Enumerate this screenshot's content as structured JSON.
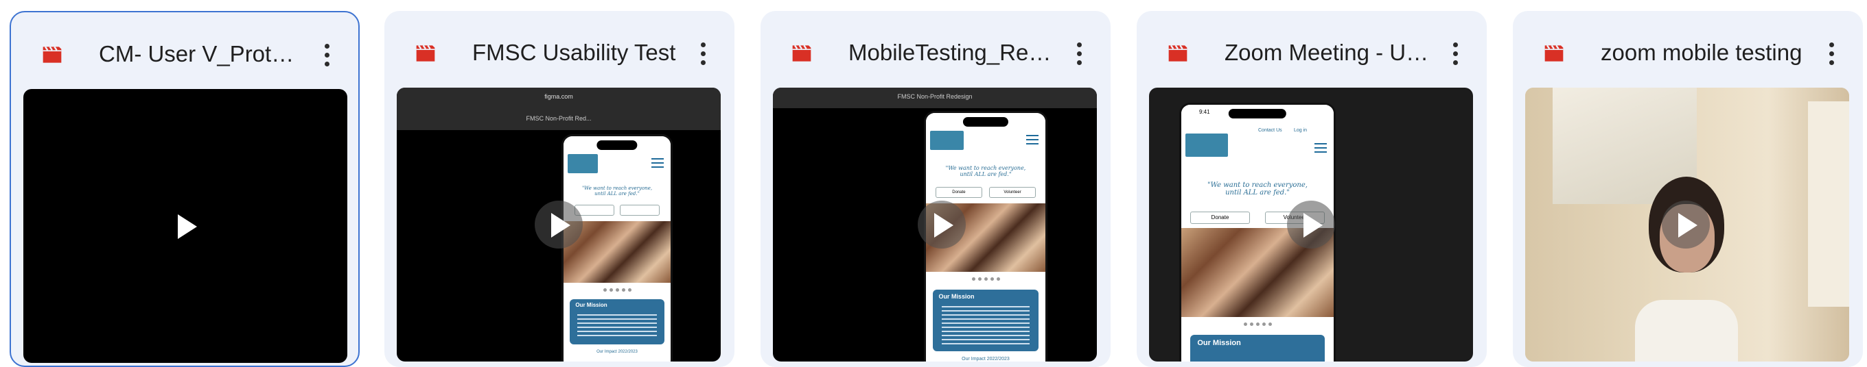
{
  "files": [
    {
      "title": "CM- User V_Protocol",
      "selected": true
    },
    {
      "title": "FMSC Usability Test",
      "selected": false
    },
    {
      "title": "MobileTesting_Recording",
      "selected": false
    },
    {
      "title": "Zoom Meeting - Usability",
      "selected": false
    },
    {
      "title": "zoom mobile testing",
      "selected": false
    }
  ],
  "colors": {
    "file_icon": "#d93025",
    "selected_border": "#3d73d1",
    "card_bg": "#eef2fa",
    "site_blue": "#2e6f9a"
  },
  "icons": {
    "file_type": "video-file-icon",
    "menu": "more-vert-icon",
    "play": "play-icon"
  },
  "browser": {
    "url": "figma.com",
    "tab_title": "FMSC Non-Profit Red...",
    "prototype_title": "FMSC Non-Profit Redesign"
  },
  "site": {
    "quote_line1": "\"We want to reach everyone,",
    "quote_line2": "until ALL are fed.\"",
    "donate": "Donate",
    "volunteer": "Volunteer",
    "mission_title": "Our Mission",
    "impact_title": "Our Impact 2022/2023",
    "nav_contact": "Contact Us",
    "nav_login": "Log in",
    "time": "9:41"
  }
}
